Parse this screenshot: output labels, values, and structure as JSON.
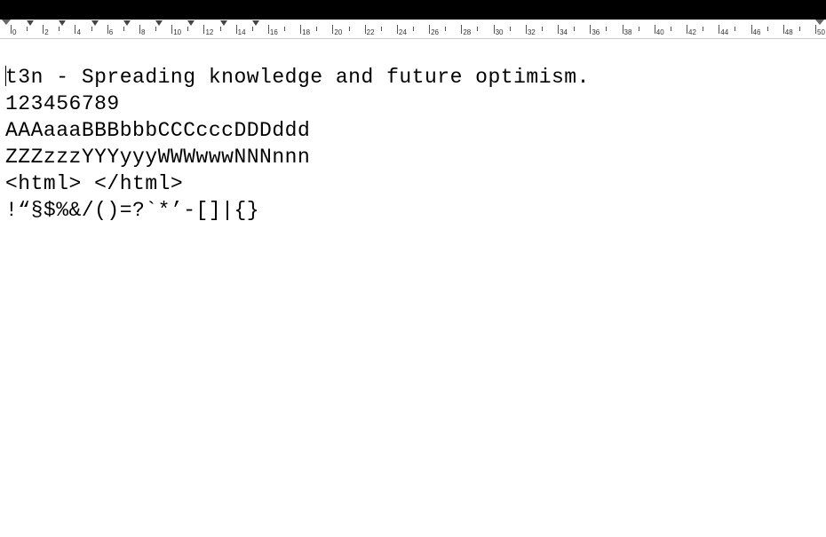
{
  "ruler": {
    "unit": "cm",
    "min": 0,
    "max": 50,
    "major_step": 2,
    "tab_stops_cm": [
      1,
      3,
      5,
      7,
      9,
      11,
      13,
      15
    ]
  },
  "document": {
    "lines": [
      "t3n - Spreading knowledge and future optimism.",
      "123456789",
      "AAAaaaBBBbbbCCCcccDDDddd",
      "ZZZzzzYYYyyyWWWwwwNNNnnn",
      "<html> </html>",
      "!“§$%&/()=?`*’-[]|{}"
    ]
  }
}
